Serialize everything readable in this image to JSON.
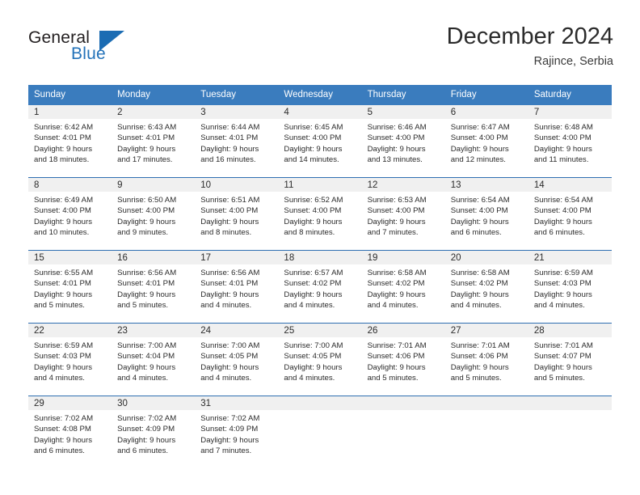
{
  "brand": {
    "name_part1": "General",
    "name_part2": "Blue"
  },
  "header": {
    "title": "December 2024",
    "subtitle": "Rajince, Serbia"
  },
  "colors": {
    "header_blue": "#3a7cbe",
    "row_divider_blue": "#2f6fb2",
    "daynum_band": "#f0f0f0",
    "logo_blue": "#2372b9",
    "text": "#2b2b2b"
  },
  "calendar": {
    "weekday_headers": [
      "Sunday",
      "Monday",
      "Tuesday",
      "Wednesday",
      "Thursday",
      "Friday",
      "Saturday"
    ],
    "weeks": [
      [
        {
          "day": "1",
          "sunrise": "Sunrise: 6:42 AM",
          "sunset": "Sunset: 4:01 PM",
          "daylight_line1": "Daylight: 9 hours",
          "daylight_line2": "and 18 minutes."
        },
        {
          "day": "2",
          "sunrise": "Sunrise: 6:43 AM",
          "sunset": "Sunset: 4:01 PM",
          "daylight_line1": "Daylight: 9 hours",
          "daylight_line2": "and 17 minutes."
        },
        {
          "day": "3",
          "sunrise": "Sunrise: 6:44 AM",
          "sunset": "Sunset: 4:01 PM",
          "daylight_line1": "Daylight: 9 hours",
          "daylight_line2": "and 16 minutes."
        },
        {
          "day": "4",
          "sunrise": "Sunrise: 6:45 AM",
          "sunset": "Sunset: 4:00 PM",
          "daylight_line1": "Daylight: 9 hours",
          "daylight_line2": "and 14 minutes."
        },
        {
          "day": "5",
          "sunrise": "Sunrise: 6:46 AM",
          "sunset": "Sunset: 4:00 PM",
          "daylight_line1": "Daylight: 9 hours",
          "daylight_line2": "and 13 minutes."
        },
        {
          "day": "6",
          "sunrise": "Sunrise: 6:47 AM",
          "sunset": "Sunset: 4:00 PM",
          "daylight_line1": "Daylight: 9 hours",
          "daylight_line2": "and 12 minutes."
        },
        {
          "day": "7",
          "sunrise": "Sunrise: 6:48 AM",
          "sunset": "Sunset: 4:00 PM",
          "daylight_line1": "Daylight: 9 hours",
          "daylight_line2": "and 11 minutes."
        }
      ],
      [
        {
          "day": "8",
          "sunrise": "Sunrise: 6:49 AM",
          "sunset": "Sunset: 4:00 PM",
          "daylight_line1": "Daylight: 9 hours",
          "daylight_line2": "and 10 minutes."
        },
        {
          "day": "9",
          "sunrise": "Sunrise: 6:50 AM",
          "sunset": "Sunset: 4:00 PM",
          "daylight_line1": "Daylight: 9 hours",
          "daylight_line2": "and 9 minutes."
        },
        {
          "day": "10",
          "sunrise": "Sunrise: 6:51 AM",
          "sunset": "Sunset: 4:00 PM",
          "daylight_line1": "Daylight: 9 hours",
          "daylight_line2": "and 8 minutes."
        },
        {
          "day": "11",
          "sunrise": "Sunrise: 6:52 AM",
          "sunset": "Sunset: 4:00 PM",
          "daylight_line1": "Daylight: 9 hours",
          "daylight_line2": "and 8 minutes."
        },
        {
          "day": "12",
          "sunrise": "Sunrise: 6:53 AM",
          "sunset": "Sunset: 4:00 PM",
          "daylight_line1": "Daylight: 9 hours",
          "daylight_line2": "and 7 minutes."
        },
        {
          "day": "13",
          "sunrise": "Sunrise: 6:54 AM",
          "sunset": "Sunset: 4:00 PM",
          "daylight_line1": "Daylight: 9 hours",
          "daylight_line2": "and 6 minutes."
        },
        {
          "day": "14",
          "sunrise": "Sunrise: 6:54 AM",
          "sunset": "Sunset: 4:00 PM",
          "daylight_line1": "Daylight: 9 hours",
          "daylight_line2": "and 6 minutes."
        }
      ],
      [
        {
          "day": "15",
          "sunrise": "Sunrise: 6:55 AM",
          "sunset": "Sunset: 4:01 PM",
          "daylight_line1": "Daylight: 9 hours",
          "daylight_line2": "and 5 minutes."
        },
        {
          "day": "16",
          "sunrise": "Sunrise: 6:56 AM",
          "sunset": "Sunset: 4:01 PM",
          "daylight_line1": "Daylight: 9 hours",
          "daylight_line2": "and 5 minutes."
        },
        {
          "day": "17",
          "sunrise": "Sunrise: 6:56 AM",
          "sunset": "Sunset: 4:01 PM",
          "daylight_line1": "Daylight: 9 hours",
          "daylight_line2": "and 4 minutes."
        },
        {
          "day": "18",
          "sunrise": "Sunrise: 6:57 AM",
          "sunset": "Sunset: 4:02 PM",
          "daylight_line1": "Daylight: 9 hours",
          "daylight_line2": "and 4 minutes."
        },
        {
          "day": "19",
          "sunrise": "Sunrise: 6:58 AM",
          "sunset": "Sunset: 4:02 PM",
          "daylight_line1": "Daylight: 9 hours",
          "daylight_line2": "and 4 minutes."
        },
        {
          "day": "20",
          "sunrise": "Sunrise: 6:58 AM",
          "sunset": "Sunset: 4:02 PM",
          "daylight_line1": "Daylight: 9 hours",
          "daylight_line2": "and 4 minutes."
        },
        {
          "day": "21",
          "sunrise": "Sunrise: 6:59 AM",
          "sunset": "Sunset: 4:03 PM",
          "daylight_line1": "Daylight: 9 hours",
          "daylight_line2": "and 4 minutes."
        }
      ],
      [
        {
          "day": "22",
          "sunrise": "Sunrise: 6:59 AM",
          "sunset": "Sunset: 4:03 PM",
          "daylight_line1": "Daylight: 9 hours",
          "daylight_line2": "and 4 minutes."
        },
        {
          "day": "23",
          "sunrise": "Sunrise: 7:00 AM",
          "sunset": "Sunset: 4:04 PM",
          "daylight_line1": "Daylight: 9 hours",
          "daylight_line2": "and 4 minutes."
        },
        {
          "day": "24",
          "sunrise": "Sunrise: 7:00 AM",
          "sunset": "Sunset: 4:05 PM",
          "daylight_line1": "Daylight: 9 hours",
          "daylight_line2": "and 4 minutes."
        },
        {
          "day": "25",
          "sunrise": "Sunrise: 7:00 AM",
          "sunset": "Sunset: 4:05 PM",
          "daylight_line1": "Daylight: 9 hours",
          "daylight_line2": "and 4 minutes."
        },
        {
          "day": "26",
          "sunrise": "Sunrise: 7:01 AM",
          "sunset": "Sunset: 4:06 PM",
          "daylight_line1": "Daylight: 9 hours",
          "daylight_line2": "and 5 minutes."
        },
        {
          "day": "27",
          "sunrise": "Sunrise: 7:01 AM",
          "sunset": "Sunset: 4:06 PM",
          "daylight_line1": "Daylight: 9 hours",
          "daylight_line2": "and 5 minutes."
        },
        {
          "day": "28",
          "sunrise": "Sunrise: 7:01 AM",
          "sunset": "Sunset: 4:07 PM",
          "daylight_line1": "Daylight: 9 hours",
          "daylight_line2": "and 5 minutes."
        }
      ],
      [
        {
          "day": "29",
          "sunrise": "Sunrise: 7:02 AM",
          "sunset": "Sunset: 4:08 PM",
          "daylight_line1": "Daylight: 9 hours",
          "daylight_line2": "and 6 minutes."
        },
        {
          "day": "30",
          "sunrise": "Sunrise: 7:02 AM",
          "sunset": "Sunset: 4:09 PM",
          "daylight_line1": "Daylight: 9 hours",
          "daylight_line2": "and 6 minutes."
        },
        {
          "day": "31",
          "sunrise": "Sunrise: 7:02 AM",
          "sunset": "Sunset: 4:09 PM",
          "daylight_line1": "Daylight: 9 hours",
          "daylight_line2": "and 7 minutes."
        },
        {
          "day": "",
          "sunrise": "",
          "sunset": "",
          "daylight_line1": "",
          "daylight_line2": ""
        },
        {
          "day": "",
          "sunrise": "",
          "sunset": "",
          "daylight_line1": "",
          "daylight_line2": ""
        },
        {
          "day": "",
          "sunrise": "",
          "sunset": "",
          "daylight_line1": "",
          "daylight_line2": ""
        },
        {
          "day": "",
          "sunrise": "",
          "sunset": "",
          "daylight_line1": "",
          "daylight_line2": ""
        }
      ]
    ]
  }
}
